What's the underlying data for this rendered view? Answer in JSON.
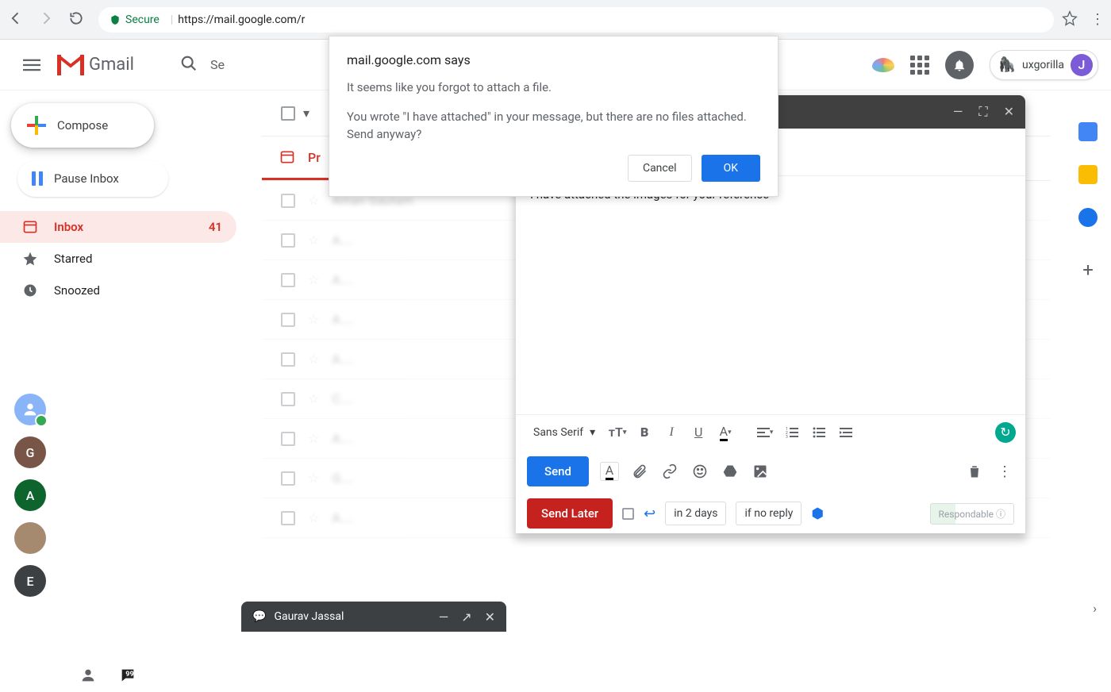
{
  "browser": {
    "secure_label": "Secure",
    "url": "https://mail.google.com/r"
  },
  "header": {
    "app_name": "Gmail",
    "search_placeholder": "Se",
    "profile_name": "uxgorilla",
    "profile_initial": "J"
  },
  "sidebar": {
    "compose_label": "Compose",
    "pause_label": "Pause Inbox",
    "nav": {
      "inbox": {
        "label": "Inbox",
        "count": "41"
      },
      "starred": {
        "label": "Starred"
      },
      "snoozed": {
        "label": "Snoozed"
      }
    },
    "contacts": [
      {
        "initial": "",
        "color": "#8ab4f8"
      },
      {
        "initial": "G",
        "color": "#795548"
      },
      {
        "initial": "A",
        "color": "#0d652d"
      },
      {
        "initial": "",
        "color": "#a58a6f"
      },
      {
        "initial": "E",
        "color": "#3c4043"
      }
    ]
  },
  "tabs": {
    "primary": "Pr"
  },
  "mail_rows": [
    "Aman Gautam",
    "A....",
    "A....",
    "A....",
    "A....",
    "C....",
    "A....",
    "G....",
    "A...."
  ],
  "compose": {
    "body_text": "I have attached the images for your reference",
    "font_label": "Sans Serif",
    "send": "Send",
    "send_later": "Send Later",
    "reminder_in": "in 2 days",
    "reminder_if": "if no reply",
    "respondable": "Respondable"
  },
  "chat": {
    "name": "Gaurav Jassal"
  },
  "dialog": {
    "title": "mail.google.com says",
    "line1": "It seems like you forgot to attach a file.",
    "line2": "You wrote \"I have attached\" in your message, but there are no files attached. Send anyway?",
    "cancel": "Cancel",
    "ok": "OK"
  }
}
